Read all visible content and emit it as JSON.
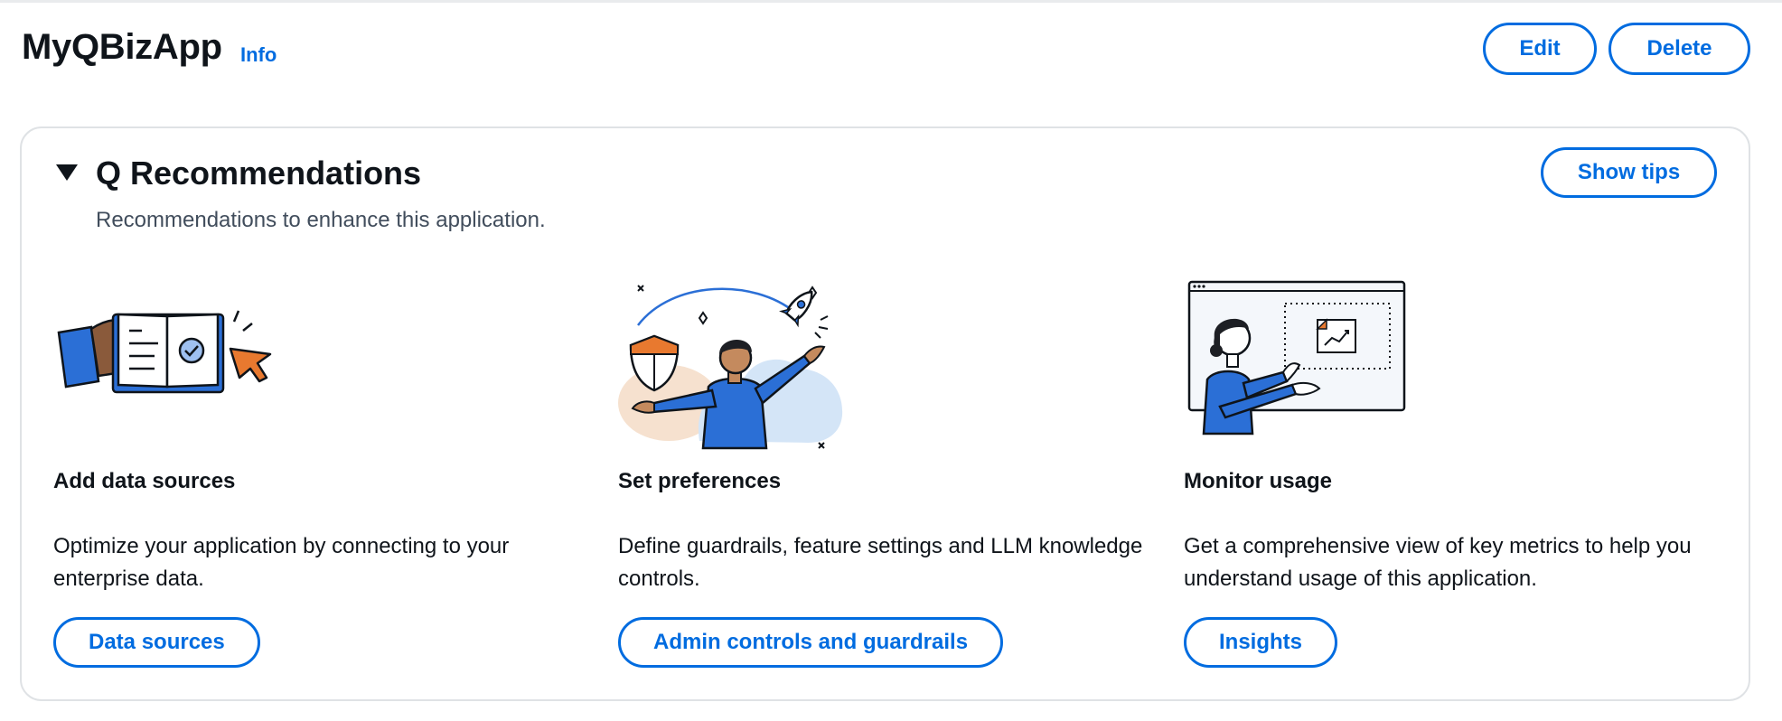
{
  "header": {
    "title": "MyQBizApp",
    "info_label": "Info",
    "edit_label": "Edit",
    "delete_label": "Delete"
  },
  "recommendations": {
    "title": "Q Recommendations",
    "description": "Recommendations to enhance this application.",
    "show_tips_label": "Show tips",
    "cards": [
      {
        "title": "Add data sources",
        "description": "Optimize your application by connecting to your enterprise data.",
        "button_label": "Data sources",
        "illustration": "book-hand-cursor-icon"
      },
      {
        "title": "Set preferences",
        "description": "Define guardrails, feature settings and LLM knowledge controls.",
        "button_label": "Admin controls and guardrails",
        "illustration": "shield-person-rocket-icon"
      },
      {
        "title": "Monitor usage",
        "description": "Get a comprehensive view of key metrics to help you understand usage of this application.",
        "button_label": "Insights",
        "illustration": "person-dashboard-chart-icon"
      }
    ]
  },
  "colors": {
    "accent": "#006ce0",
    "text": "#0f141a",
    "secondary_text": "#414d5c",
    "border": "#dfe2e5",
    "illustration_blue": "#2b6fd6",
    "illustration_orange": "#e8792f"
  }
}
